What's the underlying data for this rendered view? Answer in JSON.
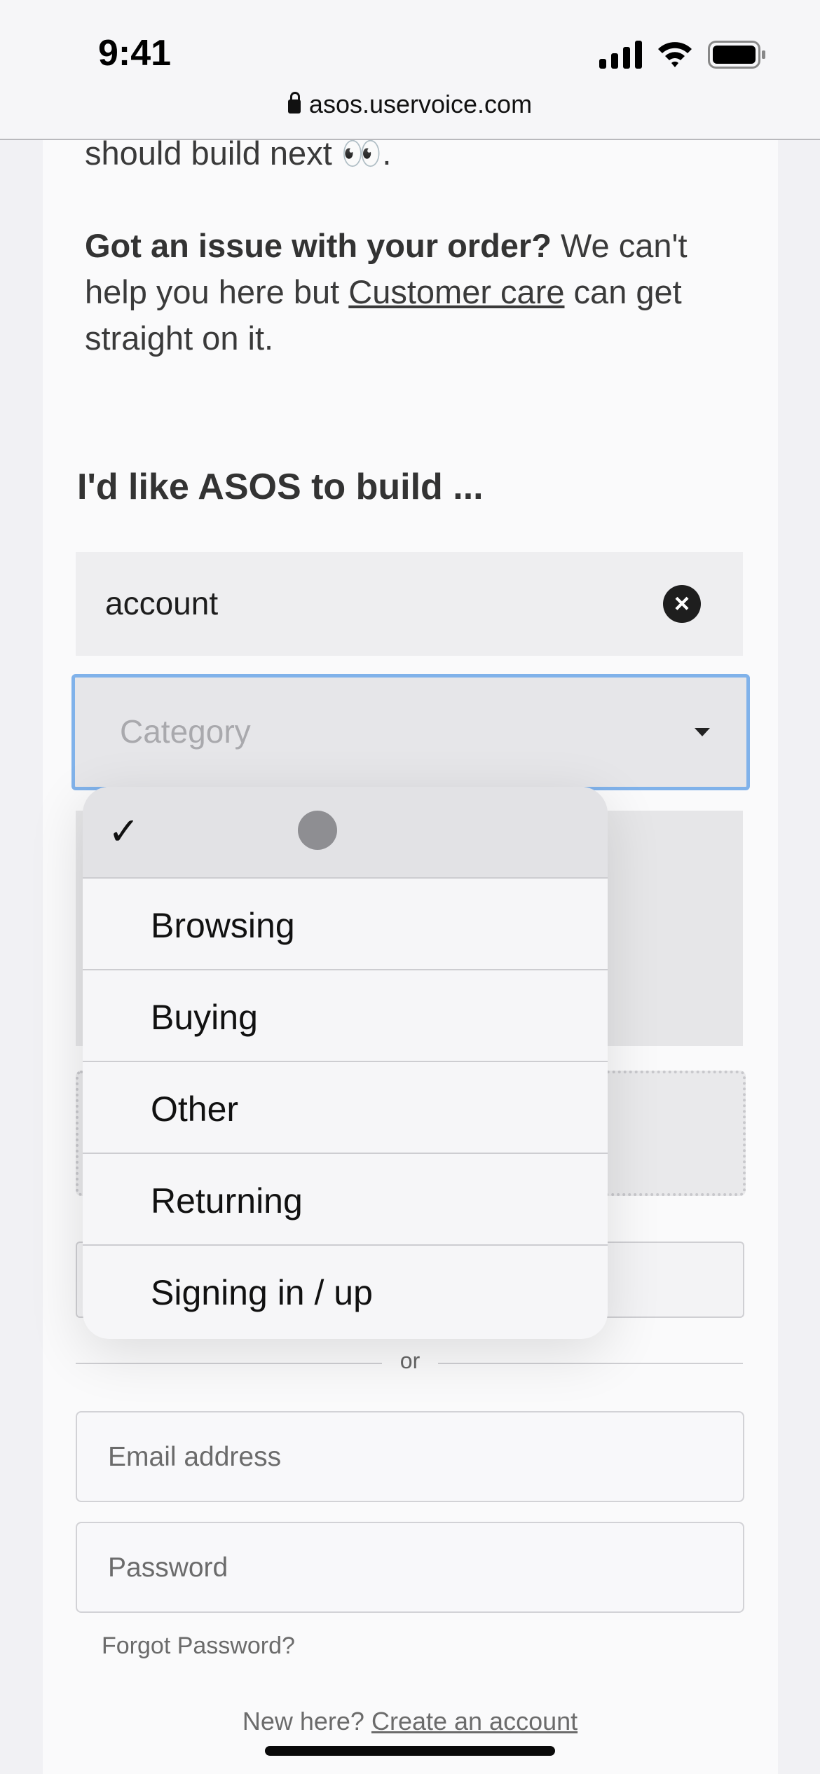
{
  "status_bar": {
    "time": "9:41",
    "icons": [
      "cellular-signal-icon",
      "wifi-icon",
      "battery-icon"
    ]
  },
  "browser": {
    "url": "asos.uservoice.com",
    "icon": "lock-icon"
  },
  "content": {
    "intro_tail": "should build next 👀.",
    "issue_bold": "Got an issue with your order?",
    "issue_text1": " We can't help you here but ",
    "issue_link": "Customer care",
    "issue_text2": " can get straight on it.",
    "heading": "I'd like ASOS to build ..."
  },
  "form": {
    "title_value": "account",
    "category_placeholder": "Category",
    "or_label": "or",
    "email_placeholder": "Email address",
    "password_placeholder": "Password",
    "forgot_password": "Forgot Password?",
    "new_here": "New here? ",
    "create_account": "Create an account"
  },
  "dropdown": {
    "selected_mark": "✓",
    "options": [
      "Browsing",
      "Buying",
      "Other",
      "Returning",
      "Signing in / up"
    ]
  },
  "colors": {
    "focus_border": "#80b2ea"
  }
}
